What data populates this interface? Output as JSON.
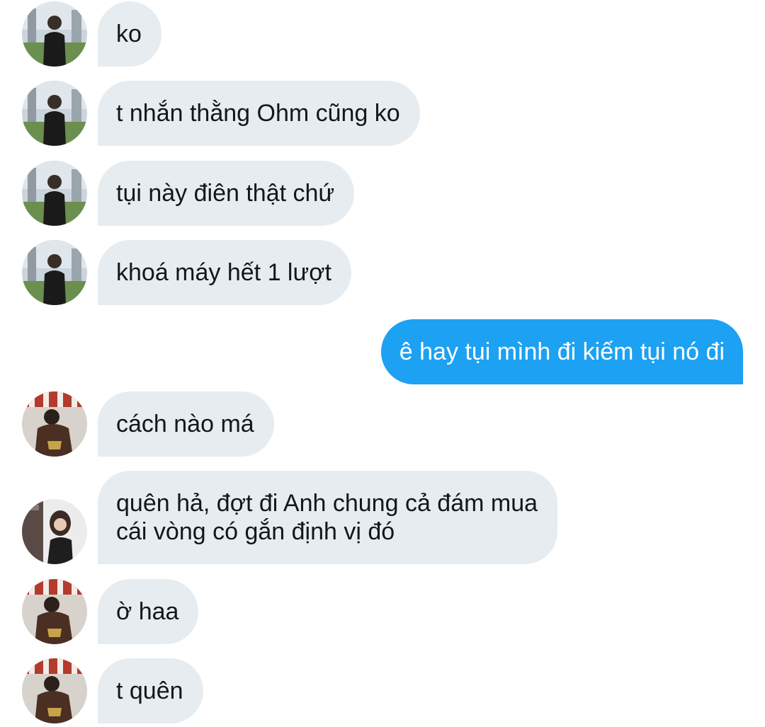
{
  "conversation": {
    "messages": [
      {
        "side": "in",
        "sender": "a",
        "text": "ko"
      },
      {
        "side": "in",
        "sender": "a",
        "text": "t nhắn thằng Ohm cũng ko"
      },
      {
        "side": "in",
        "sender": "a",
        "text": "tụi này điên thật chứ"
      },
      {
        "side": "in",
        "sender": "a",
        "text": "khoá máy hết 1 lượt"
      },
      {
        "side": "out",
        "sender": "me",
        "text": "ê hay tụi mình đi kiếm tụi nó đi"
      },
      {
        "side": "in",
        "sender": "b",
        "text": "cách nào má"
      },
      {
        "side": "in",
        "sender": "c",
        "lines": [
          "quên hả, đợt đi Anh chung cả đám mua",
          "cái vòng có gắn định vị đó"
        ]
      },
      {
        "side": "in",
        "sender": "b",
        "text": "ờ haa"
      },
      {
        "side": "in",
        "sender": "b",
        "text": "t quên"
      }
    ]
  },
  "colors": {
    "incoming_bubble": "#e6ecf0",
    "outgoing_bubble": "#1da1f2",
    "incoming_text": "#14171a",
    "outgoing_text": "#ffffff"
  },
  "icons": {
    "avatar_a": "user-photo-avatar-icon",
    "avatar_b": "user-photo-avatar-icon",
    "avatar_c": "user-photo-avatar-icon"
  }
}
